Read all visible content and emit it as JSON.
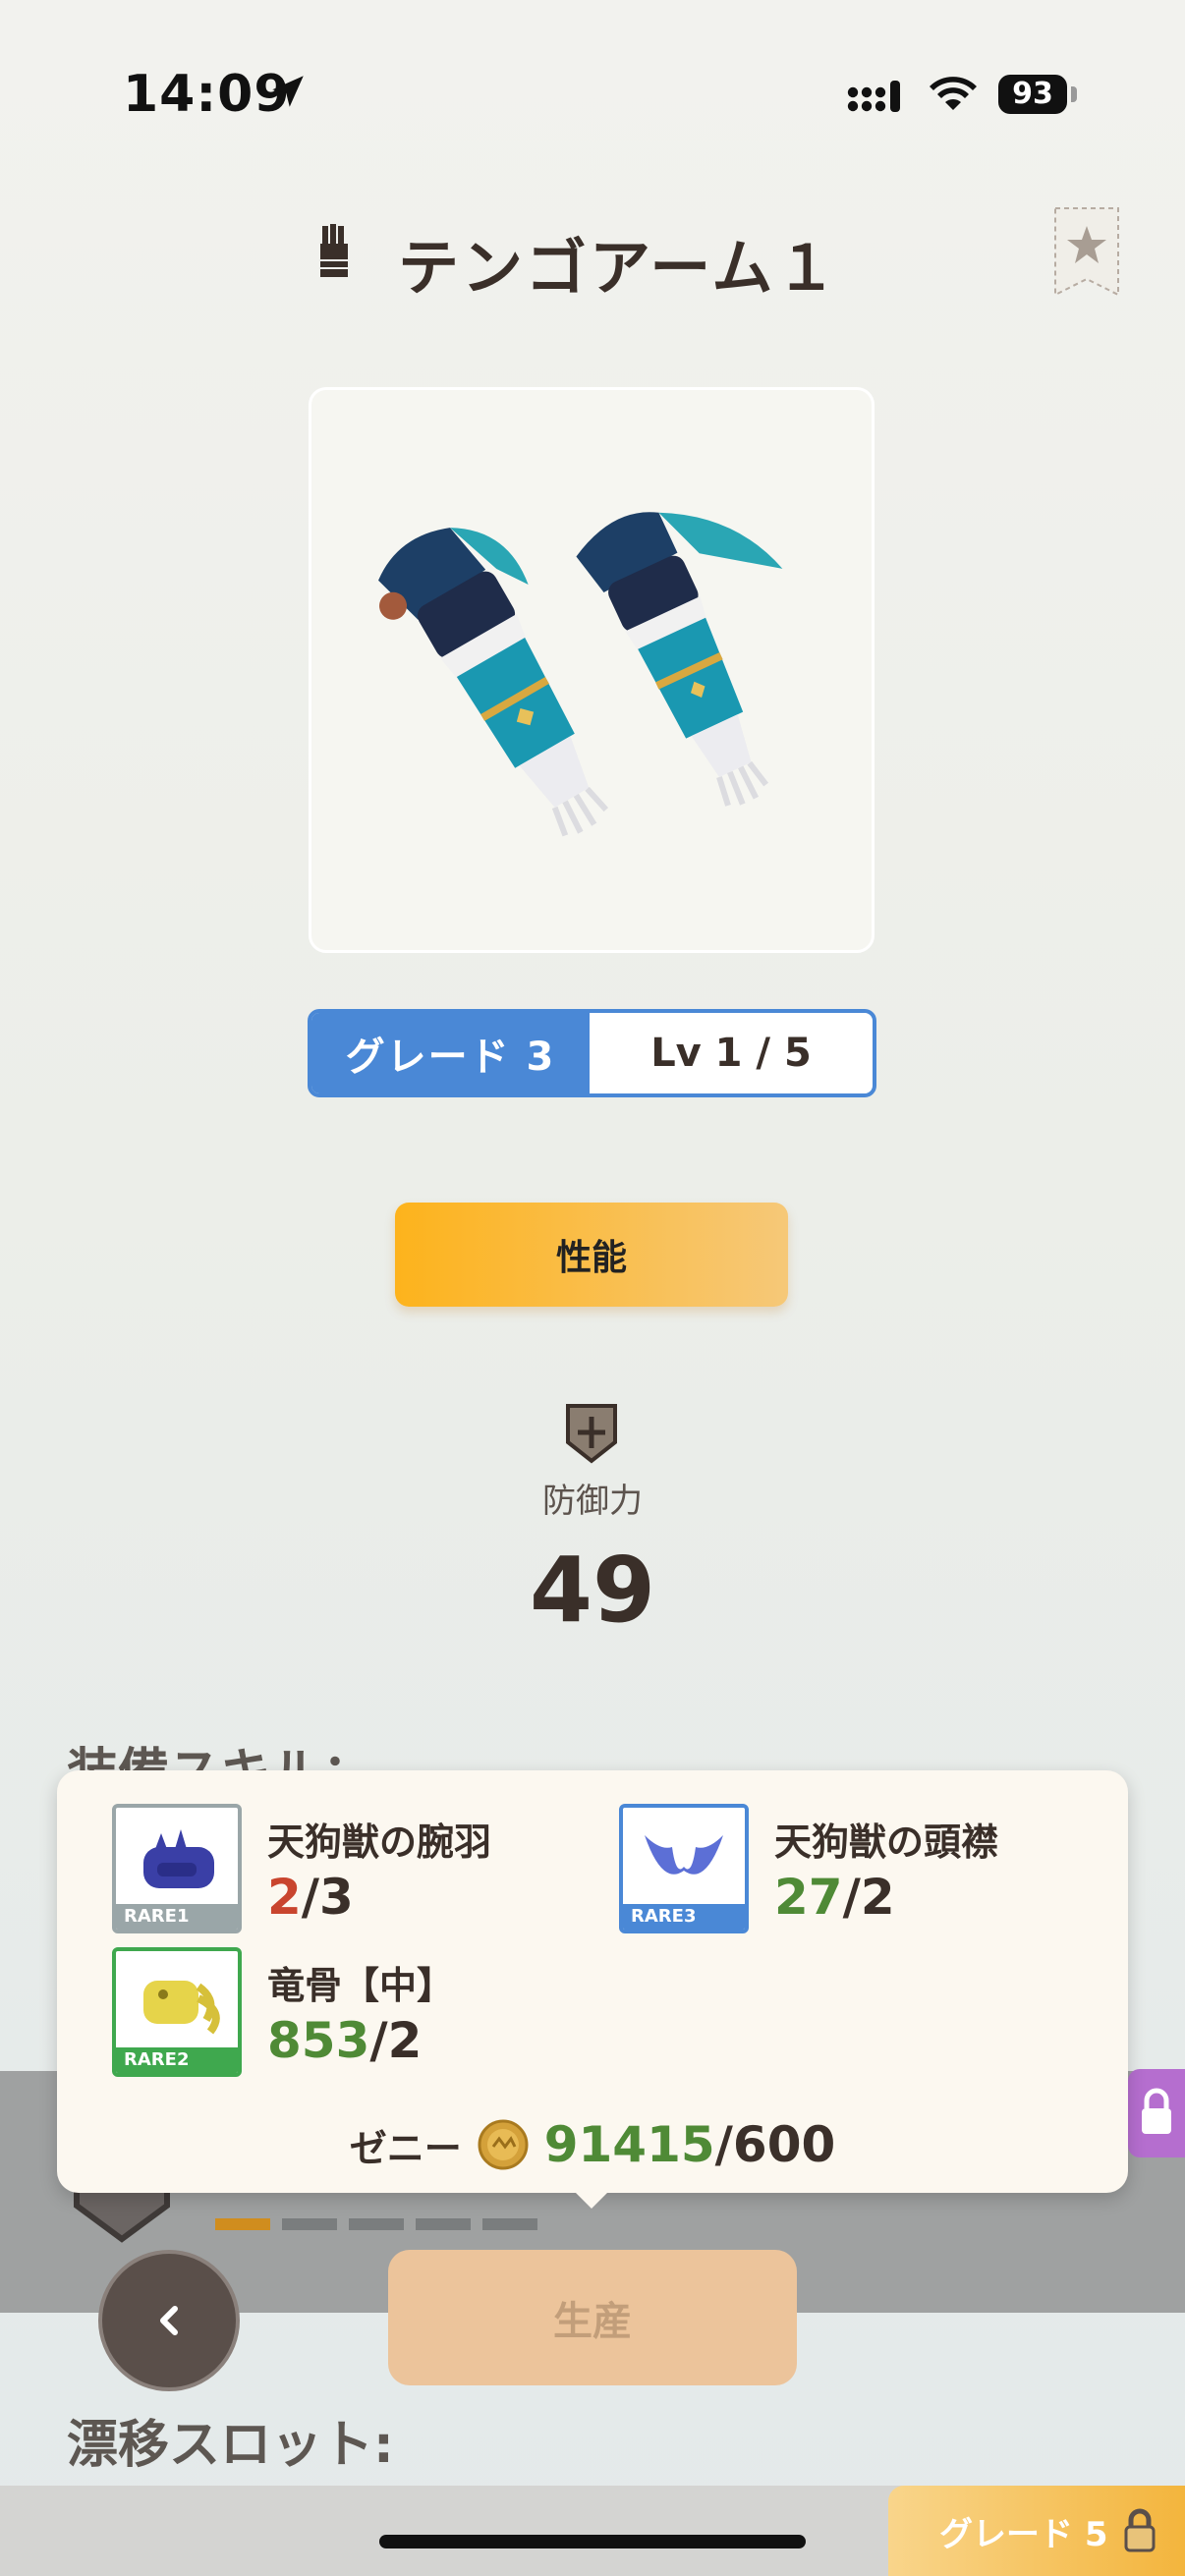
{
  "status_bar": {
    "time": "14:09",
    "battery": "93"
  },
  "header": {
    "title": "テンゴアーム１"
  },
  "grade_selector": {
    "grade": "グレード 3",
    "level": "Lv 1 / 5"
  },
  "tabs": {
    "performance": "性能"
  },
  "stats": {
    "defense_label": "防御力",
    "defense_value": "49"
  },
  "sections": {
    "skills_label": "装備スキル：",
    "drift_slot_label": "漂移スロット:"
  },
  "materials": [
    {
      "name": "天狗獣の腕羽",
      "have": "2",
      "need": "/3",
      "rarity": "RARE1",
      "have_color": "#c9452e"
    },
    {
      "name": "天狗獣の頭襟",
      "have": "27",
      "need": "/2",
      "rarity": "RARE3",
      "have_color": "#4f8a36"
    },
    {
      "name": "竜骨【中】",
      "have": "853",
      "need": "/2",
      "rarity": "RARE2",
      "have_color": "#4f8a36"
    }
  ],
  "zeny": {
    "label": "ゼニー",
    "have": "91415",
    "need": "/600"
  },
  "grade_progress": {
    "current": 1,
    "total": 5
  },
  "actions": {
    "produce": "生産"
  },
  "bottom_tab": {
    "grade5": "グレード 5"
  },
  "colors": {
    "grade_blue": "#4a88d6",
    "tab_orange": "#fdb31c",
    "ok_green": "#4f8a36",
    "lack_red": "#c9452e"
  }
}
